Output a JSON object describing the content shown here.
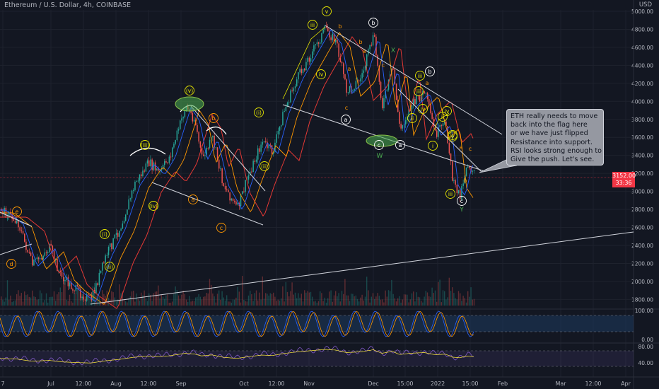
{
  "header": {
    "title": "Ethereum / U.S. Dollar, 4h, COINBASE",
    "currency": "USD"
  },
  "price_axis": {
    "labels": [
      "5000.00",
      "4800.00",
      "4600.00",
      "4400.00",
      "4200.00",
      "4000.00",
      "3800.00",
      "3600.00",
      "3400.00",
      "3200.00",
      "3000.00",
      "2800.00",
      "2600.00",
      "2400.00",
      "2200.00",
      "2000.00",
      "1800.00"
    ]
  },
  "current_price": {
    "symbol": "ETHUSD",
    "value": "3152.00",
    "countdown": "33:36"
  },
  "oscillator_1": {
    "labels": [
      "100.00",
      "0.00"
    ]
  },
  "oscillator_2": {
    "labels": [
      "80.00",
      "40.00"
    ]
  },
  "time_axis": {
    "labels": [
      "7",
      "Jul",
      "12:00",
      "Aug",
      "12:00",
      "Sep",
      "Oct",
      "12:00",
      "Nov",
      "Dec",
      "15:00",
      "2022",
      "15:00",
      "Feb",
      "Mar",
      "12:00",
      "Apr"
    ]
  },
  "annotation": {
    "lines": [
      "ETH really needs to move",
      "back into the flag here",
      "or we have just flipped",
      "Resistance into support.",
      "RSI looks strong enough to",
      "Give the push. Let's see."
    ]
  },
  "wave_labels": {
    "yellow": [
      "(i)",
      "(ii)",
      "(iii)",
      "(iv)",
      "(v)",
      "v",
      "iii",
      "iv",
      "(i)",
      "(ii)",
      "ii",
      "iii",
      "iv",
      "i",
      "ii",
      "iii",
      "iv",
      "iii",
      "iv",
      "v"
    ],
    "orange": [
      "e",
      "d",
      "a",
      "b",
      "c",
      "b",
      "a",
      "c",
      "a",
      "b",
      "c",
      "a",
      "c",
      "b",
      "a"
    ],
    "white": [
      "b",
      "a",
      "c",
      "a",
      "b",
      "c"
    ],
    "green": [
      "W",
      "X",
      "Y"
    ]
  },
  "colors": {
    "background": "#131722",
    "grid": "#1e222d",
    "candle_up": "#26a69a",
    "candle_down": "#ef5350",
    "ma_red": "#e53935",
    "ma_orange": "#ff9800",
    "ma_blue": "#2962ff",
    "trendline": "#d1d4dc",
    "wave_yellow": "#e6e600",
    "wave_orange": "#ff9800",
    "wave_green": "#4caf50",
    "price_tag": "#f23645",
    "osc_band": "#1e3a5f",
    "callout_bg": "#9598a1"
  }
}
